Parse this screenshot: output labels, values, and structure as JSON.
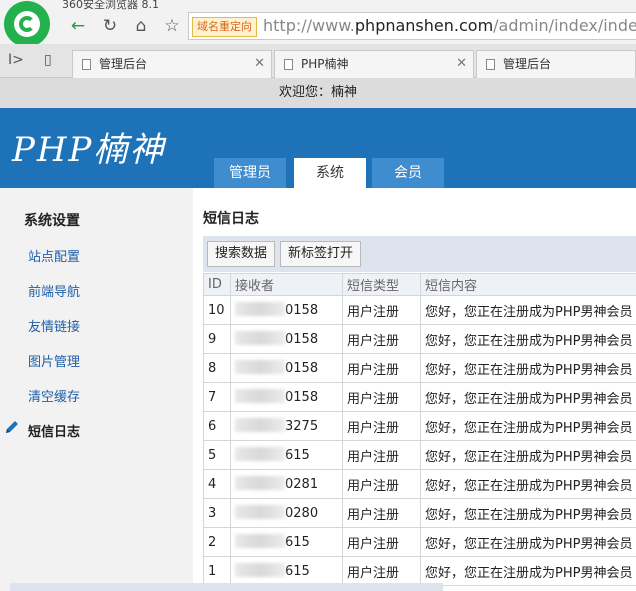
{
  "browser": {
    "window_title": "360安全浏览器 8.1",
    "redirect_badge": "域名重定向",
    "url_prefix": "http://www.",
    "url_domain": "phpnanshen.com",
    "url_path": "/admin/index/index",
    "tabs": [
      {
        "label": "管理后台"
      },
      {
        "label": "PHP楠神"
      },
      {
        "label": "管理后台"
      }
    ],
    "icons": {
      "back": "back-arrow-icon",
      "reload": "reload-icon",
      "home": "home-icon",
      "favorite": "star-icon"
    }
  },
  "welcome": "欢迎您：楠神",
  "brand": "PHP楠神",
  "main_tabs": [
    {
      "label": "管理员",
      "active": false
    },
    {
      "label": "系统",
      "active": true
    },
    {
      "label": "会员",
      "active": false
    }
  ],
  "sidebar": {
    "title": "系统设置",
    "items": [
      {
        "label": "站点配置"
      },
      {
        "label": "前端导航"
      },
      {
        "label": "友情链接"
      },
      {
        "label": "图片管理"
      },
      {
        "label": "清空缓存"
      },
      {
        "label": "短信日志",
        "active": true
      }
    ]
  },
  "main": {
    "title": "短信日志",
    "buttons": {
      "search": "搜索数据",
      "new_tab": "新标签打开"
    },
    "columns": [
      "ID",
      "接收者",
      "短信类型",
      "短信内容"
    ],
    "rows": [
      {
        "id": "10",
        "receiver_tail": "0158",
        "type": "用户注册",
        "content": "您好，您正在注册成为PHP男神会员"
      },
      {
        "id": "9",
        "receiver_tail": "0158",
        "type": "用户注册",
        "content": "您好，您正在注册成为PHP男神会员"
      },
      {
        "id": "8",
        "receiver_tail": "0158",
        "type": "用户注册",
        "content": "您好，您正在注册成为PHP男神会员"
      },
      {
        "id": "7",
        "receiver_tail": "0158",
        "type": "用户注册",
        "content": "您好，您正在注册成为PHP男神会员"
      },
      {
        "id": "6",
        "receiver_tail": "3275",
        "type": "用户注册",
        "content": "您好，您正在注册成为PHP男神会员"
      },
      {
        "id": "5",
        "receiver_tail": "615",
        "type": "用户注册",
        "content": "您好，您正在注册成为PHP男神会员"
      },
      {
        "id": "4",
        "receiver_tail": "0281",
        "type": "用户注册",
        "content": "您好，您正在注册成为PHP男神会员"
      },
      {
        "id": "3",
        "receiver_tail": "0280",
        "type": "用户注册",
        "content": "您好，您正在注册成为PHP男神会员"
      },
      {
        "id": "2",
        "receiver_tail": "615",
        "type": "用户注册",
        "content": "您好，您正在注册成为PHP男神会员"
      },
      {
        "id": "1",
        "receiver_tail": "615",
        "type": "用户注册",
        "content": "您好，您正在注册成为PHP男神会员"
      }
    ]
  },
  "colors": {
    "header": "#1e72b8",
    "tab": "#3f8ccf",
    "toolbar": "#dde4ee"
  }
}
